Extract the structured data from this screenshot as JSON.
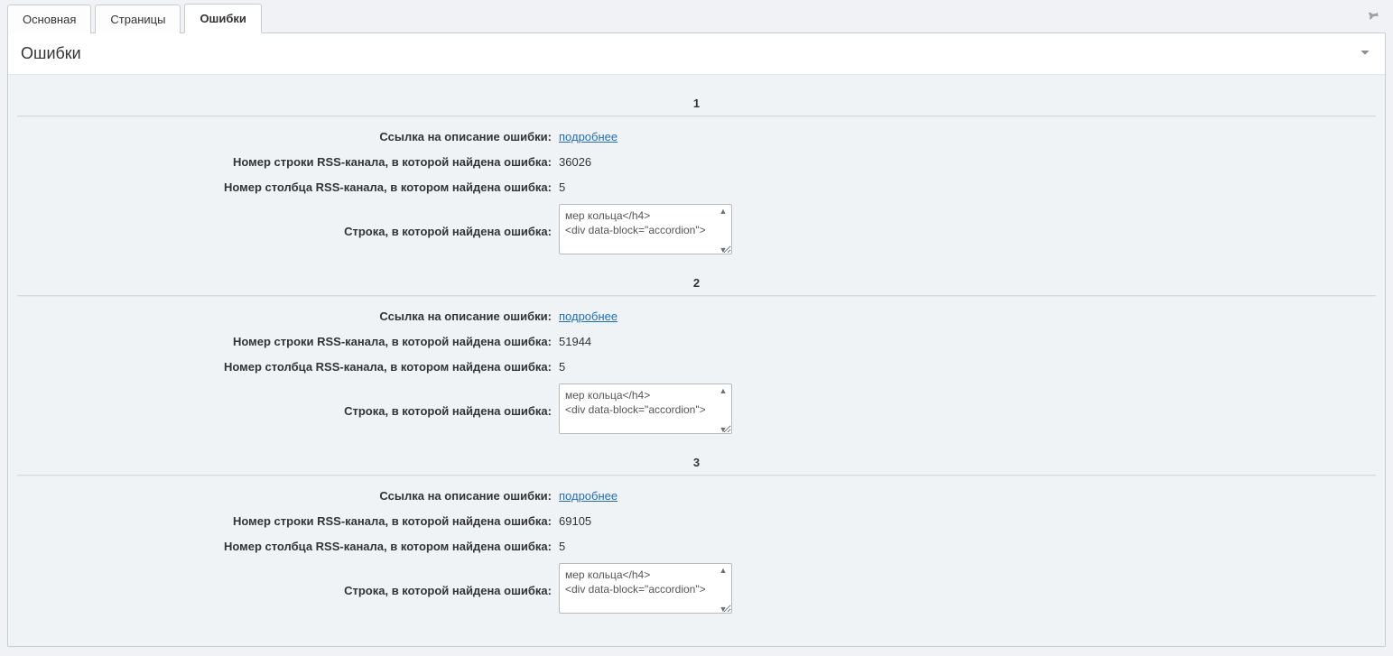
{
  "tabs": {
    "main": "Основная",
    "pages": "Страницы",
    "errors": "Ошибки"
  },
  "panel": {
    "title": "Ошибки"
  },
  "labels": {
    "link": "Ссылка на описание ошибки:",
    "row": "Номер строки RSS-канала, в которой найдена ошибка:",
    "col": "Номер столбца RSS-канала, в котором найдена ошибка:",
    "snippet": "Строка, в которой найдена ошибка:",
    "details_link": "подробнее"
  },
  "errors": [
    {
      "index": "1",
      "row": "36026",
      "col": "5",
      "snippet": "мер кольца</h4>                 <div data-block=\"accordion\">"
    },
    {
      "index": "2",
      "row": "51944",
      "col": "5",
      "snippet": "мер кольца</h4>                 <div data-block=\"accordion\">"
    },
    {
      "index": "3",
      "row": "69105",
      "col": "5",
      "snippet": "мер кольца</h4>                 <div data-block=\"accordion\">"
    }
  ]
}
